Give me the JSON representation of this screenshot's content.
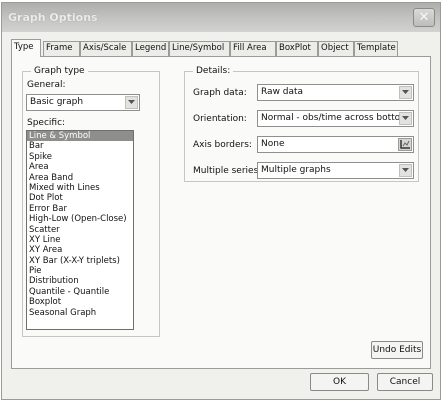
{
  "window": {
    "title": "Graph Options"
  },
  "tabs": [
    {
      "label": "Type"
    },
    {
      "label": "Frame"
    },
    {
      "label": "Axis/Scale"
    },
    {
      "label": "Legend"
    },
    {
      "label": "Line/Symbol"
    },
    {
      "label": "Fill Area"
    },
    {
      "label": "BoxPlot"
    },
    {
      "label": "Object"
    },
    {
      "label": "Template"
    }
  ],
  "graph_type": {
    "legend": "Graph type",
    "general_label": "General:",
    "general_value": "Basic graph",
    "specific_label": "Specific:",
    "items": [
      "Line & Symbol",
      "Bar",
      "Spike",
      "Area",
      "Area Band",
      "Mixed with Lines",
      "Dot Plot",
      "Error Bar",
      "High-Low (Open-Close)",
      "Scatter",
      "XY Line",
      "XY Area",
      "XY Bar (X-X-Y triplets)",
      "Pie",
      "Distribution",
      "Quantile - Quantile",
      "Boxplot",
      "Seasonal Graph"
    ],
    "selected_index": 0
  },
  "details": {
    "legend": "Details:",
    "graph_data_label": "Graph data:",
    "graph_data_value": "Raw data",
    "orientation_label": "Orientation:",
    "orientation_value": "Normal - obs/time across bottom",
    "axis_borders_label": "Axis borders:",
    "axis_borders_value": "None",
    "multiple_series_label": "Multiple series:",
    "multiple_series_value": "Multiple graphs"
  },
  "buttons": {
    "undo": "Undo Edits",
    "ok": "OK",
    "cancel": "Cancel"
  }
}
